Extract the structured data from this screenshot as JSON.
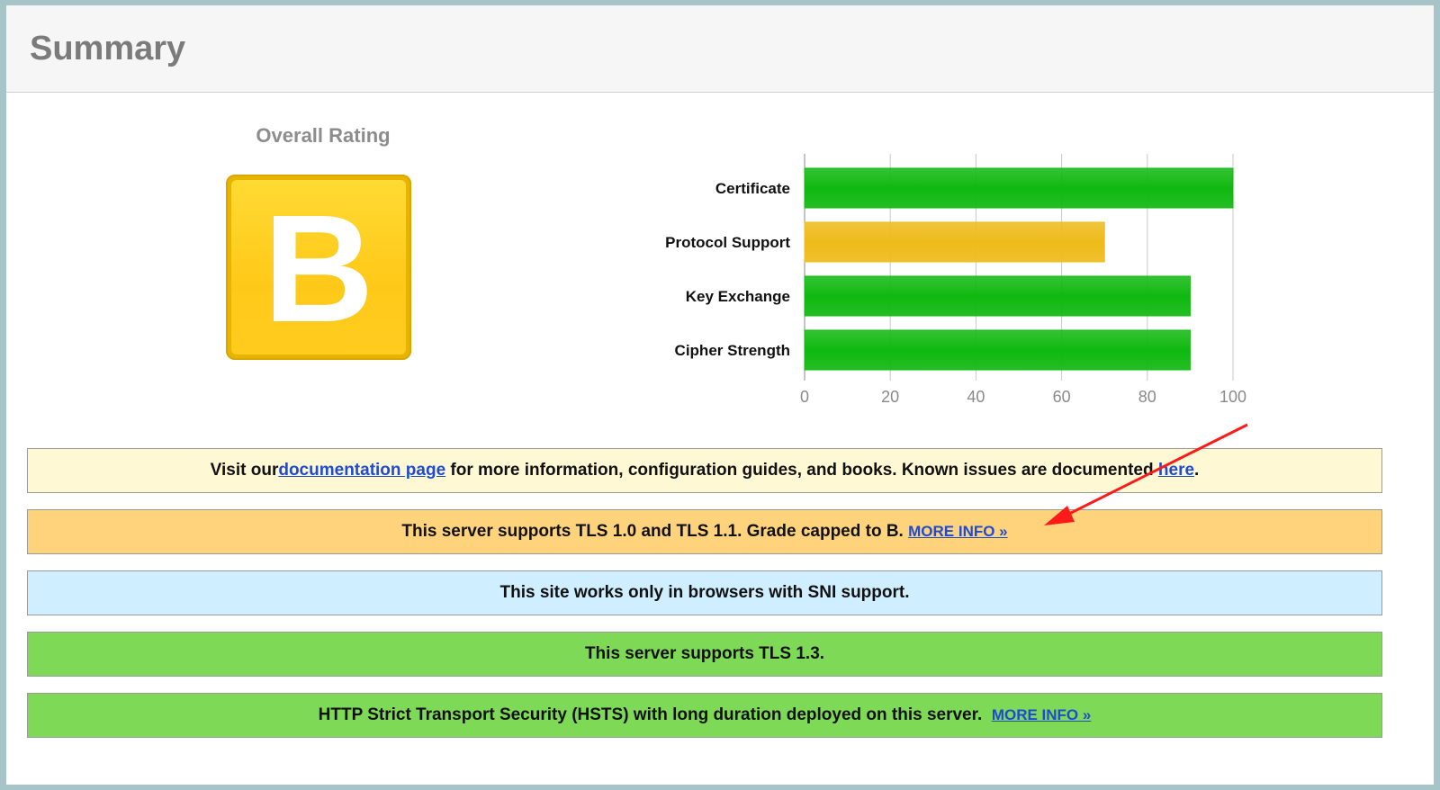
{
  "page": {
    "title": "Summary"
  },
  "rating": {
    "label": "Overall Rating",
    "grade": "B",
    "colors": {
      "outer": "#e8b400",
      "inner": "#ffcc1f",
      "letter": "#ffffff"
    }
  },
  "chart_data": {
    "type": "bar",
    "orientation": "horizontal",
    "categories": [
      "Certificate",
      "Protocol Support",
      "Key Exchange",
      "Cipher Strength"
    ],
    "values": [
      100,
      70,
      90,
      90
    ],
    "bar_colors": [
      "#10b810",
      "#eebb1a",
      "#10b810",
      "#10b810"
    ],
    "xlim": [
      0,
      100
    ],
    "xticks": [
      0,
      20,
      40,
      60,
      80,
      100
    ],
    "grid": true
  },
  "notices": {
    "documentation": {
      "text_before": "Visit our ",
      "link_text": "documentation page",
      "text_middle": " for more information, configuration guides, and books. Known issues are documented ",
      "link_text_2": "here",
      "text_after": ".",
      "bg": "#fff8d4"
    },
    "tls_legacy": {
      "text": "This server supports TLS 1.0 and TLS 1.1. Grade capped to B. ",
      "link_text": "MORE INFO »",
      "bg": "#ffd27c"
    },
    "sni": {
      "text": "This site works only in browsers with SNI support.",
      "bg": "#cfeeff"
    },
    "tls13": {
      "text": "This server supports TLS 1.3.",
      "bg": "#7ed957"
    },
    "hsts": {
      "text": "HTTP Strict Transport Security (HSTS) with long duration deployed on this server.  ",
      "link_text": "MORE INFO »",
      "bg": "#7ed957"
    }
  },
  "annotation": {
    "arrow_color": "#ff1a1a"
  }
}
